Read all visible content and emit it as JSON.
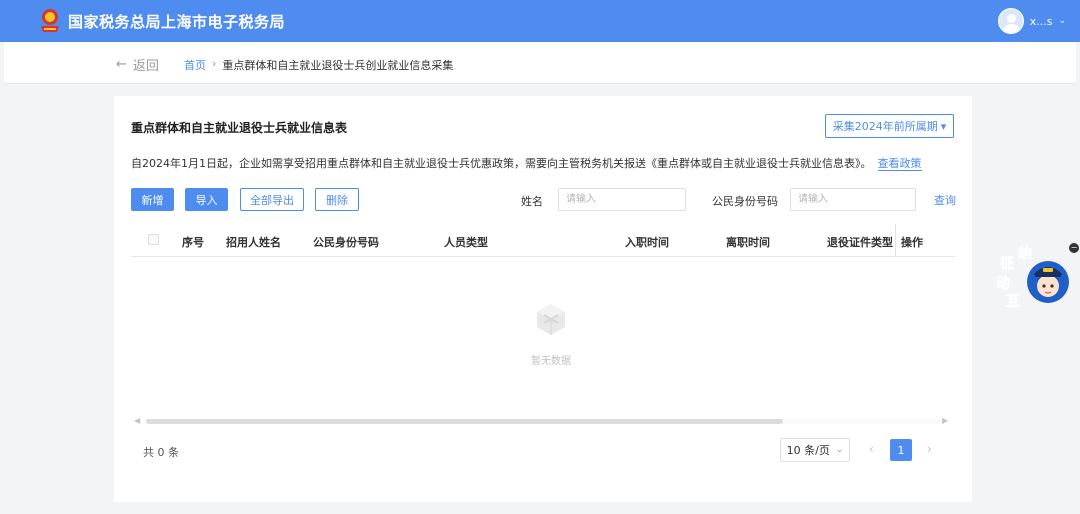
{
  "header": {
    "site_title": "国家税务总局上海市电子税务局",
    "user_name": "x...s"
  },
  "breadcrumb": {
    "back_label": "返回",
    "home": "首页",
    "current": "重点群体和自主就业退役士兵创业就业信息采集"
  },
  "card": {
    "title": "重点群体和自主就业退役士兵就业信息表",
    "period_button": "采集2024年前所属期",
    "notice": "自2024年1月1日起，企业如需享受招用重点群体和自主就业退役士兵优惠政策，需要向主管税务机关报送《重点群体或自主就业退役士兵就业信息表》。",
    "policy_link": "查看政策"
  },
  "toolbar": {
    "add": "新增",
    "import": "导入",
    "export_all": "全部导出",
    "delete": "删除",
    "name_label": "姓名",
    "name_placeholder": "请输入",
    "id_label": "公民身份号码",
    "id_placeholder": "请输入",
    "query": "查询"
  },
  "table": {
    "columns": [
      "序号",
      "招用人姓名",
      "公民身份号码",
      "人员类型",
      "入职时间",
      "离职时间",
      "退役证件类型",
      "操作"
    ],
    "empty_text": "暂无数据"
  },
  "pagination": {
    "total": "共 0 条",
    "page_size": "10 条/页",
    "current_page": "1"
  },
  "widget": {
    "text": "征纳互动"
  },
  "colors": {
    "primary": "#4e8cf0",
    "header_bg": "#4e8cf0"
  }
}
